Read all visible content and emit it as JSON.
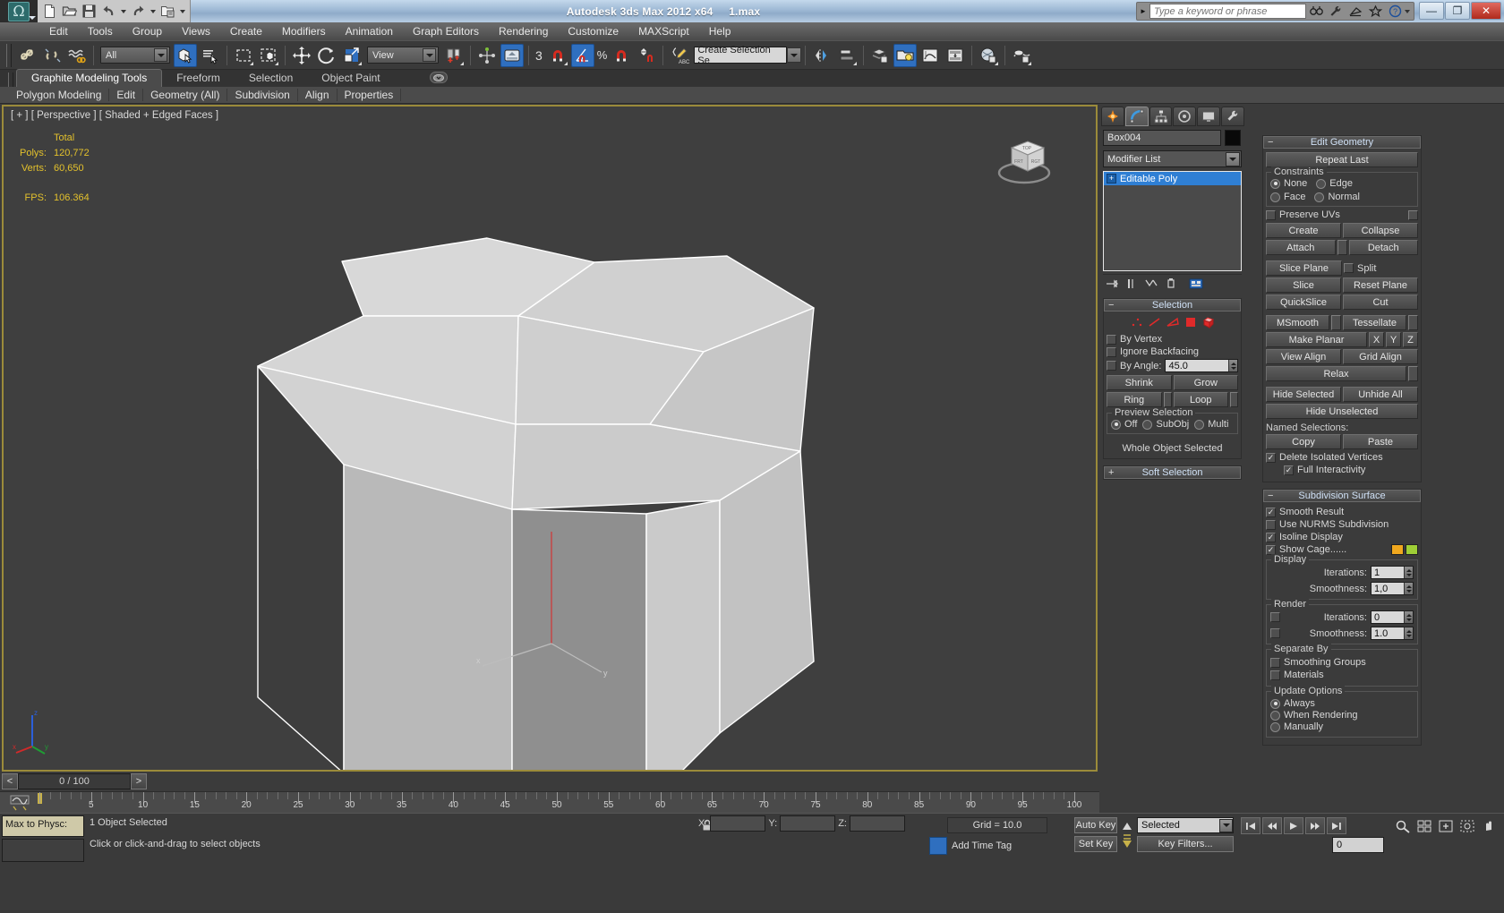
{
  "titlebar": {
    "app_title": "Autodesk 3ds Max  2012 x64",
    "file_name": "1.max",
    "quick_access": [
      {
        "name": "new-file-icon",
        "label": "New"
      },
      {
        "name": "open-file-icon",
        "label": "Open"
      },
      {
        "name": "save-file-icon",
        "label": "Save"
      },
      {
        "name": "undo-icon",
        "label": "Undo"
      },
      {
        "name": "redo-icon",
        "label": "Redo"
      },
      {
        "name": "set-project-folder-icon",
        "label": "Set Project Folder"
      }
    ],
    "infocenter": {
      "placeholder": "Type a keyword or phrase",
      "icons": [
        "search-icon",
        "subscription-wrench-icon",
        "communication-center-icon",
        "favorites-star-icon",
        "help-question-icon"
      ]
    },
    "window_buttons": [
      {
        "name": "minimize-button",
        "glyph": "—"
      },
      {
        "name": "restore-button",
        "glyph": "❐"
      },
      {
        "name": "close-button",
        "glyph": "✕"
      }
    ]
  },
  "menubar": {
    "items": [
      "Edit",
      "Tools",
      "Group",
      "Views",
      "Create",
      "Modifiers",
      "Animation",
      "Graph Editors",
      "Rendering",
      "Customize",
      "MAXScript",
      "Help"
    ]
  },
  "toolbar": {
    "selection_filter": "All",
    "reference_coord": "View",
    "named_selection_sets": "Create Selection Se",
    "angle_snap_value": "3",
    "buttons": [
      {
        "name": "select-and-link-icon",
        "label": "Select and Link"
      },
      {
        "name": "unlink-selection-icon",
        "label": "Unlink Selection"
      },
      {
        "name": "bind-to-space-warp-icon",
        "label": "Bind to Space Warp"
      },
      {
        "name": "select-object-icon",
        "label": "Select Object",
        "active": true
      },
      {
        "name": "select-by-name-icon",
        "label": "Select by Name"
      },
      {
        "name": "rectangular-selection-region-icon",
        "label": "Rectangular Selection Region"
      },
      {
        "name": "window-crossing-icon",
        "label": "Window / Crossing"
      },
      {
        "name": "select-and-move-icon",
        "label": "Select and Move"
      },
      {
        "name": "select-and-rotate-icon",
        "label": "Select and Rotate"
      },
      {
        "name": "select-and-scale-icon",
        "label": "Select and Uniform Scale"
      },
      {
        "name": "use-pivot-point-center-icon",
        "label": "Use Pivot Point Center"
      },
      {
        "name": "select-and-manipulate-icon",
        "label": "Select and Manipulate"
      },
      {
        "name": "keyboard-shortcut-override-icon",
        "label": "Keyboard Shortcut Override Toggle",
        "active": true
      },
      {
        "name": "snaps-toggle-icon",
        "label": "Snaps Toggle"
      },
      {
        "name": "angle-snap-toggle-icon",
        "label": "Angle Snap Toggle",
        "active": true
      },
      {
        "name": "percent-snap-toggle-icon",
        "label": "Percent Snap Toggle"
      },
      {
        "name": "spinner-snap-toggle-icon",
        "label": "Spinner Snap Toggle"
      },
      {
        "name": "edit-named-selection-sets-icon",
        "label": "Edit Named Selection Sets"
      },
      {
        "name": "mirror-icon",
        "label": "Mirror"
      },
      {
        "name": "align-icon",
        "label": "Align"
      },
      {
        "name": "layer-manager-icon",
        "label": "Layer Manager"
      },
      {
        "name": "light-lister-icon",
        "label": "Toggle Scene Explorer",
        "active": true
      },
      {
        "name": "curve-editor-icon",
        "label": "Curve Editor"
      },
      {
        "name": "schematic-view-icon",
        "label": "Schematic View"
      },
      {
        "name": "material-editor-icon",
        "label": "Material Editor"
      },
      {
        "name": "render-setup-icon",
        "label": "Render Setup"
      }
    ]
  },
  "ribbon": {
    "tabs": [
      {
        "label": "Graphite Modeling Tools",
        "active": true
      },
      {
        "label": "Freeform",
        "active": false
      },
      {
        "label": "Selection",
        "active": false
      },
      {
        "label": "Object Paint",
        "active": false
      }
    ],
    "panels": [
      "Polygon Modeling",
      "Edit",
      "Geometry (All)",
      "Subdivision",
      "Align",
      "Properties"
    ]
  },
  "viewport": {
    "label": "[ + ] [ Perspective ] [ Shaded + Edged Faces ]",
    "stats": {
      "header": "Total",
      "polys_label": "Polys:",
      "polys_value": "120,772",
      "verts_label": "Verts:",
      "verts_value": "60,650",
      "fps_label": "FPS:",
      "fps_value": "106.364"
    },
    "axis_labels": {
      "x": "x",
      "y": "y",
      "z": "z"
    },
    "viewcube_labels": {
      "top": "TOP",
      "front": "FRONT",
      "right": "RIGHT"
    }
  },
  "command_panel": {
    "tabs": [
      {
        "name": "create-tab",
        "icon": "star-burst-icon",
        "selected": false
      },
      {
        "name": "modify-tab",
        "icon": "blue-arc-icon",
        "selected": true
      },
      {
        "name": "hierarchy-tab",
        "icon": "hierarchy-icon",
        "selected": false
      },
      {
        "name": "motion-tab",
        "icon": "motion-wheel-icon",
        "selected": false
      },
      {
        "name": "display-tab",
        "icon": "display-monitor-icon",
        "selected": false
      },
      {
        "name": "utilities-tab",
        "icon": "hammer-icon",
        "selected": false
      }
    ],
    "object_name": "Box004",
    "modifier_list_label": "Modifier List",
    "modifier_stack": [
      {
        "label": "Editable Poly",
        "selected": true
      }
    ],
    "stack_buttons": [
      {
        "name": "pin-stack-icon"
      },
      {
        "name": "show-end-result-icon"
      },
      {
        "name": "make-unique-icon"
      },
      {
        "name": "remove-modifier-icon"
      },
      {
        "name": "configure-modifier-sets-icon"
      }
    ],
    "selection_rollout": {
      "title": "Selection",
      "sub_object_icons": [
        "vertex-icon",
        "edge-icon",
        "border-icon",
        "polygon-icon",
        "element-icon"
      ],
      "by_vertex": {
        "label": "By Vertex",
        "checked": false
      },
      "ignore_backfacing": {
        "label": "Ignore Backfacing",
        "checked": false
      },
      "by_angle": {
        "label": "By Angle:",
        "checked": false,
        "value": "45.0"
      },
      "shrink": "Shrink",
      "grow": "Grow",
      "ring": "Ring",
      "loop": "Loop",
      "preview_selection_label": "Preview Selection",
      "preview_options": [
        {
          "label": "Off",
          "selected": true
        },
        {
          "label": "SubObj",
          "selected": false
        },
        {
          "label": "Multi",
          "selected": false
        }
      ],
      "status_text": "Whole Object Selected"
    },
    "soft_selection_rollout": {
      "title": "Soft Selection",
      "collapsed": true
    },
    "edit_geometry_rollout": {
      "title": "Edit Geometry",
      "repeat_last": "Repeat Last",
      "constraints_label": "Constraints",
      "constraints": [
        {
          "label": "None",
          "selected": true
        },
        {
          "label": "Edge",
          "selected": false
        },
        {
          "label": "Face",
          "selected": false
        },
        {
          "label": "Normal",
          "selected": false
        }
      ],
      "preserve_uvs": {
        "label": "Preserve UVs",
        "checked": false
      },
      "create": "Create",
      "collapse": "Collapse",
      "attach": "Attach",
      "detach": "Detach",
      "slice_plane": "Slice Plane",
      "split": {
        "label": "Split",
        "checked": false
      },
      "slice": "Slice",
      "reset_plane": "Reset Plane",
      "quickslice": "QuickSlice",
      "cut": "Cut",
      "msmooth": "MSmooth",
      "tessellate": "Tessellate",
      "make_planar": "Make Planar",
      "axis_x": "X",
      "axis_y": "Y",
      "axis_z": "Z",
      "view_align": "View Align",
      "grid_align": "Grid Align",
      "relax": "Relax",
      "hide_selected": "Hide Selected",
      "unhide_all": "Unhide All",
      "hide_unselected": "Hide Unselected",
      "named_selections_label": "Named Selections:",
      "copy": "Copy",
      "paste": "Paste",
      "delete_isolated_vertices": {
        "label": "Delete Isolated Vertices",
        "checked": true
      },
      "full_interactivity": {
        "label": "Full Interactivity",
        "checked": true
      }
    },
    "subdivision_surface_rollout": {
      "title": "Subdivision Surface",
      "smooth_result": {
        "label": "Smooth Result",
        "checked": true
      },
      "use_nurms": {
        "label": "Use NURMS Subdivision",
        "checked": false
      },
      "isoline_display": {
        "label": "Isoline Display",
        "checked": true
      },
      "show_cage": {
        "label": "Show Cage......",
        "checked": true,
        "color1": "#f0a81e",
        "color2": "#9ece36"
      },
      "display_group": "Display",
      "display_iterations": {
        "label": "Iterations:",
        "value": "1"
      },
      "display_smoothness": {
        "label": "Smoothness:",
        "value": "1,0"
      },
      "render_group": "Render",
      "render_iterations": {
        "label": "Iterations:",
        "value": "0",
        "checked": false
      },
      "render_smoothness": {
        "label": "Smoothness:",
        "value": "1.0",
        "checked": false
      },
      "separate_by_group": "Separate By",
      "separate_smoothing_groups": {
        "label": "Smoothing Groups",
        "checked": false
      },
      "separate_materials": {
        "label": "Materials",
        "checked": false
      },
      "update_options_group": "Update Options",
      "update_options": [
        {
          "label": "Always",
          "selected": true
        },
        {
          "label": "When Rendering",
          "selected": false
        },
        {
          "label": "Manually",
          "selected": false
        }
      ]
    }
  },
  "timeline": {
    "frame_display": "0 / 100",
    "prev_frame": "<",
    "next_frame": ">",
    "ruler_labels": [
      "5",
      "10",
      "15",
      "20",
      "25",
      "30",
      "35",
      "40",
      "45",
      "50",
      "55",
      "60",
      "65",
      "70",
      "75",
      "80",
      "85",
      "90",
      "95",
      "100"
    ],
    "ruler_max": 100,
    "current_frame": 0
  },
  "statusbar": {
    "maxscript_label": "Max to Physc:",
    "selection_status": "1 Object Selected",
    "prompt_text": "Click or click-and-drag to select objects",
    "lock_icon": "lock-selection-icon",
    "coords": [
      {
        "label": "X:",
        "value": ""
      },
      {
        "label": "Y:",
        "value": ""
      },
      {
        "label": "Z:",
        "value": ""
      }
    ],
    "grid_label": "Grid = 10.0",
    "add_time_tag": "Add Time Tag",
    "key_mode_icon": "key-mode-icon",
    "auto_key": "Auto Key",
    "set_key": "Set Key",
    "filter_value": "Selected",
    "key_filters": "Key Filters...",
    "current_frame_field": "0",
    "transport_icons": [
      "go-to-start-icon",
      "previous-frame-icon",
      "play-animation-icon",
      "next-frame-icon",
      "go-to-end-icon"
    ],
    "nav_icons": [
      "zoom-icon",
      "zoom-all-icon",
      "zoom-extents-icon",
      "zoom-region-icon",
      "pan-icon",
      "orbit-icon",
      "maximize-viewport-icon"
    ]
  }
}
